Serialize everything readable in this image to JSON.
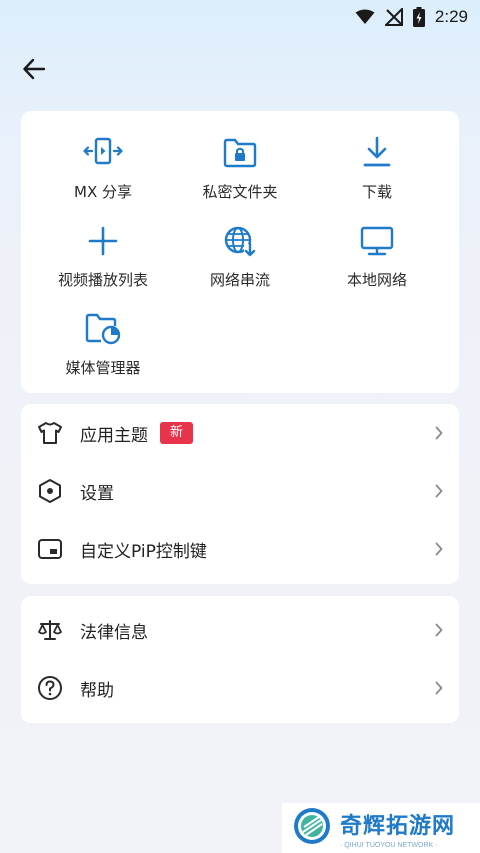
{
  "status_bar": {
    "time": "2:29"
  },
  "grid": {
    "items": [
      {
        "label": "MX 分享",
        "icon": "mx-share-icon"
      },
      {
        "label": "私密文件夹",
        "icon": "private-folder-icon"
      },
      {
        "label": "下载",
        "icon": "download-icon"
      },
      {
        "label": "视频播放列表",
        "icon": "add-icon"
      },
      {
        "label": "网络串流",
        "icon": "network-stream-icon"
      },
      {
        "label": "本地网络",
        "icon": "local-network-icon"
      },
      {
        "label": "媒体管理器",
        "icon": "media-manager-icon"
      }
    ]
  },
  "list1": {
    "theme": {
      "label": "应用主题",
      "badge": "新"
    },
    "settings": {
      "label": "设置"
    },
    "pip": {
      "label": "自定义PiP控制键"
    }
  },
  "list2": {
    "legal": {
      "label": "法律信息"
    },
    "help": {
      "label": "帮助"
    }
  },
  "watermark": {
    "title": "奇辉拓游网",
    "subtitle": "· QIHUI TUOYOU NETWORK ·"
  },
  "colors": {
    "accent": "#1f7bc9",
    "badge": "#e8344a",
    "background": "#f2f3f8",
    "card": "#ffffff"
  }
}
